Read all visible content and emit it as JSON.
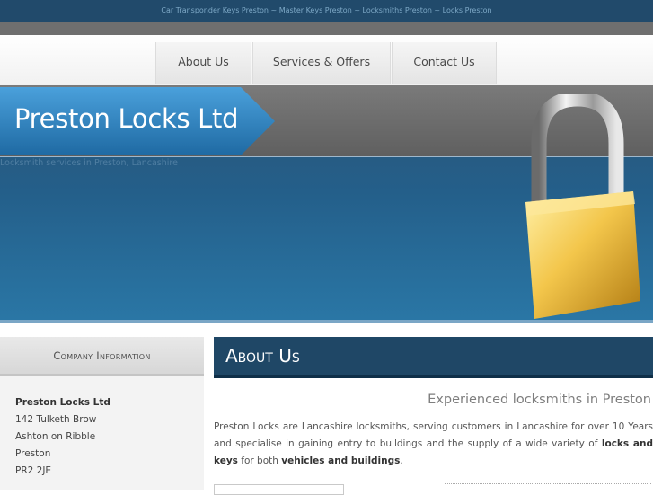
{
  "topbar": {
    "text": "Car Transponder Keys Preston ~ Master Keys Preston ~ Locksmiths Preston ~ Locks Preston"
  },
  "nav": {
    "items": [
      "About Us",
      "Services & Offers",
      "Contact Us"
    ]
  },
  "hero": {
    "title": "Preston Locks Ltd",
    "tagline": "Locksmith services in Preston, Lancashire"
  },
  "sidebar": {
    "heading": "Company Information",
    "company": "Preston Locks Ltd",
    "address": [
      "142 Tulketh Brow",
      "Ashton on Ribble",
      "Preston",
      "PR2 2JE"
    ]
  },
  "main": {
    "heading": "About Us",
    "subheading": "Experienced locksmiths in Preston",
    "para": {
      "t1": "Preston Locks are Lancashire locksmiths, serving customers in Lancashire for over 10 Years and specialise in gaining entry to buildings and the supply of a wide variety of ",
      "b1": "locks and keys",
      "t2": " for both ",
      "b2": "vehicles and buildings",
      "t3": "."
    }
  },
  "colors": {
    "brand_dark": "#1f4766",
    "banner_blue": "#2a77a6",
    "lock_gold": "#e0b43a"
  }
}
